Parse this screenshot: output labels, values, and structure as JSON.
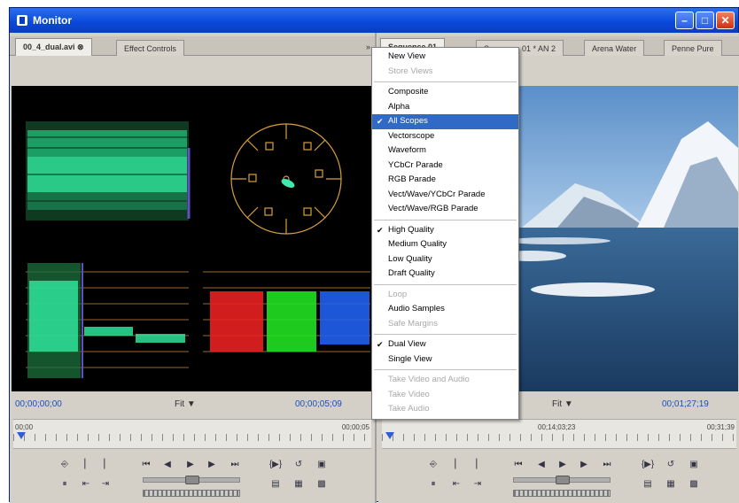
{
  "window": {
    "title": "Monitor",
    "buttons": [
      "minimize",
      "maximize",
      "close"
    ]
  },
  "left_pane": {
    "tabs": [
      {
        "label": "00_4_dual.avi",
        "active": true
      },
      {
        "label": "Effect Controls",
        "active": false
      }
    ],
    "tab_menu": "»",
    "timecode_in": "00;00;00;00",
    "fit_label": "Fit",
    "timecode_out": "00;00;05;09",
    "ruler_start": "00;00",
    "ruler_end": "00;00;05"
  },
  "right_pane": {
    "tabs": [
      {
        "label": "Sequence 01",
        "active": true
      },
      {
        "label": "Sequence 01 * AN 2",
        "active": false
      },
      {
        "label": "Arena Water",
        "active": false
      },
      {
        "label": "Penne Pure",
        "active": false
      }
    ],
    "timecode_out": "00;01;27;19",
    "fit_label": "Fit",
    "ruler_mid": "00;14;03;23",
    "ruler_end": "00;31;39"
  },
  "context_menu": {
    "items": [
      {
        "label": "New View",
        "disabled": false,
        "checked": false,
        "highlighted": false
      },
      {
        "label": "Store Views",
        "disabled": true,
        "checked": false,
        "highlighted": false
      },
      {
        "sep": true
      },
      {
        "label": "Composite",
        "disabled": false,
        "checked": false,
        "highlighted": false
      },
      {
        "label": "Alpha",
        "disabled": false,
        "checked": false,
        "highlighted": false
      },
      {
        "label": "All Scopes",
        "disabled": false,
        "checked": true,
        "highlighted": true
      },
      {
        "label": "Vectorscope",
        "disabled": false,
        "checked": false,
        "highlighted": false
      },
      {
        "label": "Waveform",
        "disabled": false,
        "checked": false,
        "highlighted": false
      },
      {
        "label": "YCbCr Parade",
        "disabled": false,
        "checked": false,
        "highlighted": false
      },
      {
        "label": "RGB Parade",
        "disabled": false,
        "checked": false,
        "highlighted": false
      },
      {
        "label": "Vect/Wave/YCbCr Parade",
        "disabled": false,
        "checked": false,
        "highlighted": false
      },
      {
        "label": "Vect/Wave/RGB Parade",
        "disabled": false,
        "checked": false,
        "highlighted": false
      },
      {
        "sep": true
      },
      {
        "label": "High Quality",
        "disabled": false,
        "checked": true,
        "highlighted": false
      },
      {
        "label": "Medium Quality",
        "disabled": false,
        "checked": false,
        "highlighted": false
      },
      {
        "label": "Low Quality",
        "disabled": false,
        "checked": false,
        "highlighted": false
      },
      {
        "label": "Draft Quality",
        "disabled": false,
        "checked": false,
        "highlighted": false
      },
      {
        "sep": true
      },
      {
        "label": "Loop",
        "disabled": true,
        "checked": false,
        "highlighted": false
      },
      {
        "label": "Audio Samples",
        "disabled": false,
        "checked": false,
        "highlighted": false
      },
      {
        "label": "Safe Margins",
        "disabled": true,
        "checked": false,
        "highlighted": false
      },
      {
        "sep": true
      },
      {
        "label": "Dual View",
        "disabled": false,
        "checked": true,
        "highlighted": false
      },
      {
        "label": "Single View",
        "disabled": false,
        "checked": false,
        "highlighted": false
      },
      {
        "sep": true
      },
      {
        "label": "Take Video and Audio",
        "disabled": true,
        "checked": false,
        "highlighted": false
      },
      {
        "label": "Take Video",
        "disabled": true,
        "checked": false,
        "highlighted": false
      },
      {
        "label": "Take Audio",
        "disabled": true,
        "checked": false,
        "highlighted": false
      }
    ]
  },
  "colors": {
    "title_bar": "#0a48d8",
    "menu_highlight": "#316ac5",
    "timecode": "#1a50b8",
    "waveform": "#2fe39a",
    "parade_red": "#e82020",
    "parade_green": "#20e020",
    "parade_blue": "#2060f0",
    "vectorscope": "#d8a040"
  }
}
